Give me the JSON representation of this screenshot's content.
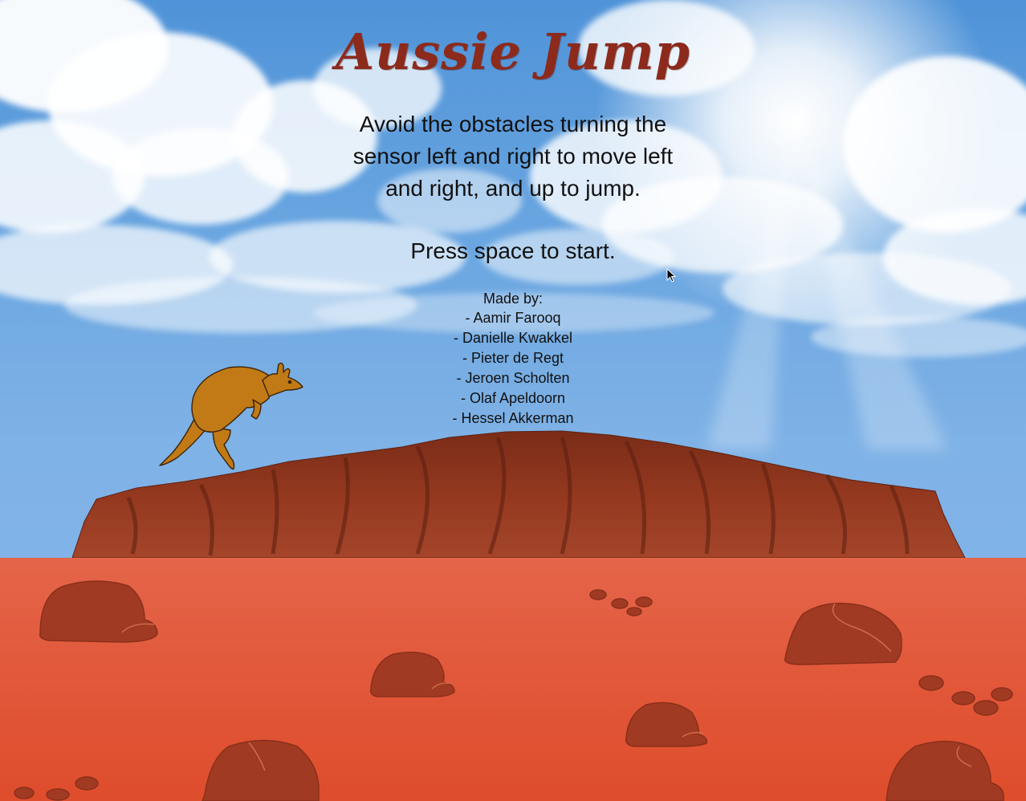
{
  "game": {
    "title": "Aussie Jump",
    "instructions": [
      "Avoid the obstacles turning the",
      "sensor left and right to move  left",
      "and right, and up to jump."
    ],
    "start_prompt": "Press space to start.",
    "credits": {
      "heading": "Made by:",
      "members": [
        "- Aamir Farooq",
        "- Danielle Kwakkel",
        "- Pieter de Regt",
        "- Jeroen Scholten",
        "- Olaf Apeldoorn",
        "- Hessel Akkerman"
      ]
    }
  },
  "scene": {
    "sky_color": "#6aa6e1",
    "ground_color": "#e2593b",
    "rock_color": "#8a3520",
    "title_color": "#8c2a1c",
    "player": "kangaroo-icon",
    "obstacles": "boulder-icon",
    "landmark": "uluru-rock"
  }
}
